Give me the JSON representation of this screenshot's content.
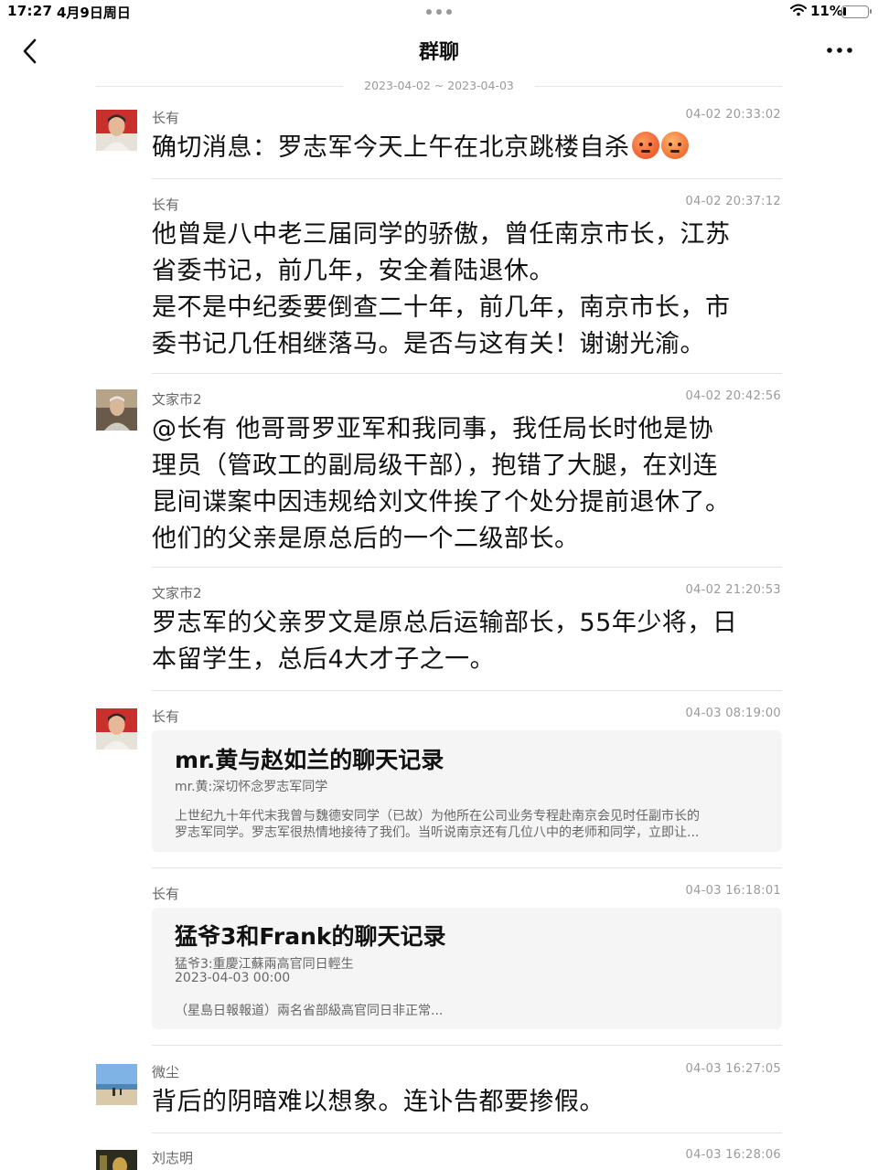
{
  "status_bar": {
    "time": "17:27",
    "date": "4月9日周日",
    "battery_percent": "11%",
    "battery_level": 0.11
  },
  "nav": {
    "title": "群聊",
    "back_icon": "chevron-left-icon",
    "more_icon": "ellipsis-icon"
  },
  "date_range": "2023-04-02 ~ 2023-04-03",
  "messages": [
    {
      "sender": "长有",
      "time": "04-02 20:33:02",
      "text": "确切消息：罗志军今天上午在北京跳楼自杀",
      "emojis": [
        "angry-face-emoji",
        "anxious-sweat-face-emoji"
      ]
    },
    {
      "sender": "长有",
      "time": "04-02 20:37:12",
      "lines": [
        "他曾是八中老三届同学的骄傲，曾任南京市长，江苏",
        "省委书记，前几年，安全着陆退休。",
        "是不是中纪委要倒查二十年，前几年，南京市长，市",
        "委书记几任相继落马。是否与这有关！谢谢光渝。"
      ]
    },
    {
      "sender": "文家市2",
      "time": "04-02 20:42:56",
      "lines": [
        "@长有  他哥哥罗亚军和我同事，我任局长时他是协",
        "理员（管政工的副局级干部），抱错了大腿，在刘连",
        "昆间谍案中因违规给刘文件挨了个处分提前退休了。",
        "他们的父亲是原总后的一个二级部长。"
      ]
    },
    {
      "sender": "文家市2",
      "time": "04-02 21:20:53",
      "lines": [
        "罗志军的父亲罗文是原总后运输部长，55年少将，日",
        "本留学生，总后4大才子之一。"
      ]
    },
    {
      "sender": "长有",
      "time": "04-03 08:19:00",
      "card": {
        "title": "mr.黄与赵如兰的聊天记录",
        "line1": "mr.黄:深切怀念罗志军同学",
        "body_lines": [
          "上世纪九十年代末我曾与魏德安同学（已故）为他所在公司业务专程赴南京会见时任副市长的",
          "罗志军同学。罗志军很热情地接待了我们。当听说南京还有几位八中的老师和同学，立即让..."
        ]
      }
    },
    {
      "sender": "长有",
      "time": "04-03 16:18:01",
      "card": {
        "title": "猛爷3和Frank的聊天记录",
        "line1": "猛爷3:重慶江蘇兩高官同日輕生",
        "line2": "2023-04-03 00:00",
        "body_lines": [
          "（星島日報報道）兩名省部級高官同日非正常..."
        ]
      }
    },
    {
      "sender": "微尘",
      "time": "04-03 16:27:05",
      "text": "背后的阴暗难以想象。连讣告都要掺假。"
    },
    {
      "sender": "刘志明",
      "time": "04-03 16:28:06"
    }
  ]
}
